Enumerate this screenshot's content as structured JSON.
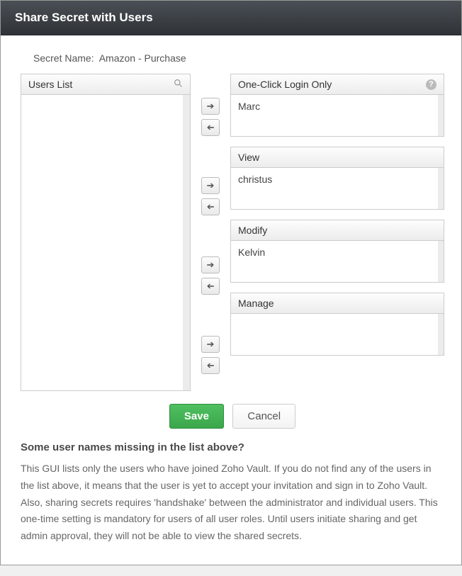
{
  "dialog": {
    "title": "Share Secret with Users",
    "secret_name_label": "Secret Name:",
    "secret_name_value": "Amazon - Purchase"
  },
  "users_list": {
    "header": "Users List"
  },
  "groups": [
    {
      "key": "oneclick",
      "header": "One-Click Login Only",
      "has_help": true,
      "items": [
        "Marc"
      ]
    },
    {
      "key": "view",
      "header": "View",
      "has_help": false,
      "items": [
        "christus"
      ]
    },
    {
      "key": "modify",
      "header": "Modify",
      "has_help": false,
      "items": [
        "Kelvin"
      ]
    },
    {
      "key": "manage",
      "header": "Manage",
      "has_help": false,
      "items": []
    }
  ],
  "buttons": {
    "save": "Save",
    "cancel": "Cancel"
  },
  "info": {
    "heading": "Some user names missing in the list above?",
    "body": "This GUI lists only the users who have joined Zoho Vault. If you do not find any of the users in the list above, it means that the user is yet to accept your invitation and sign in to Zoho Vault. Also, sharing secrets requires 'handshake' between the administrator and individual users. This one-time setting is mandatory for users of all user roles. Until users initiate sharing and get admin approval, they will not be able to view the shared secrets."
  }
}
